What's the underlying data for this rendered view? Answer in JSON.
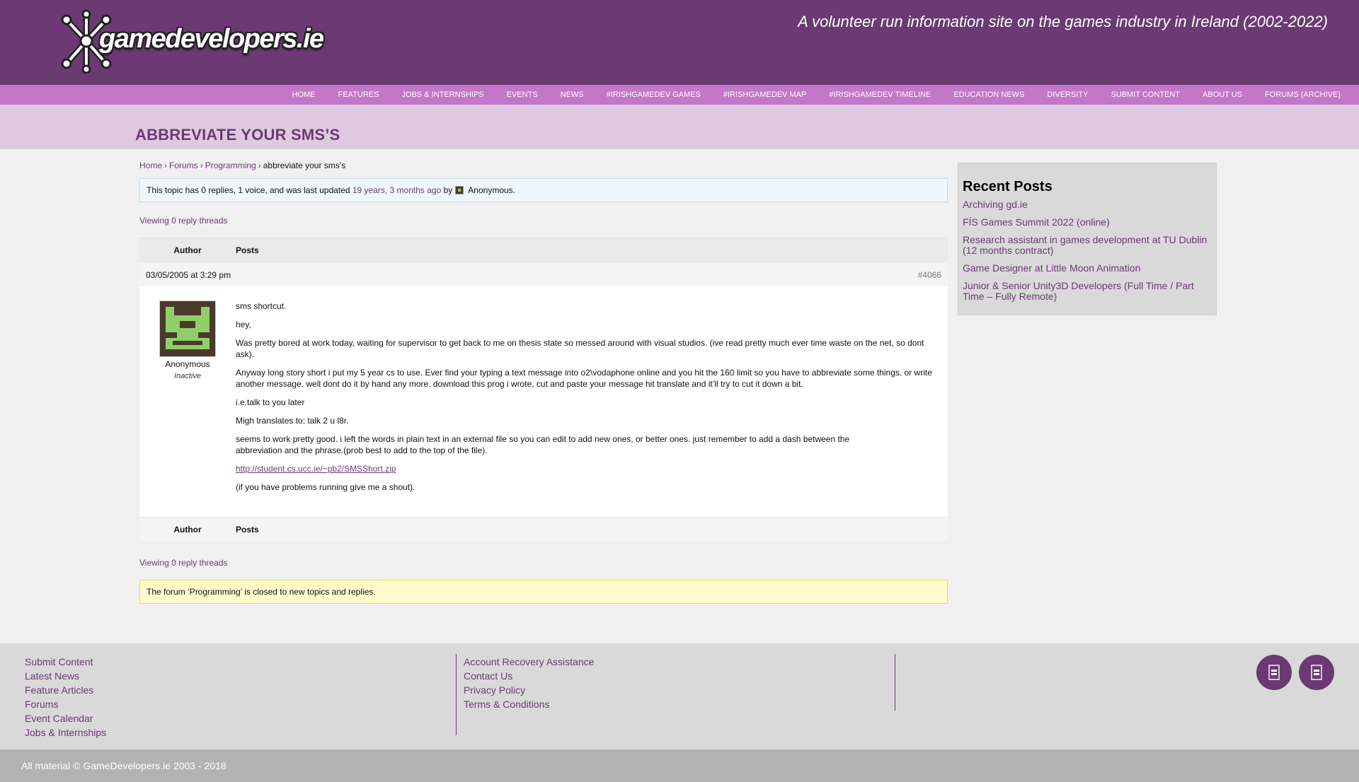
{
  "header": {
    "logo_text": "gamedevelopers.ie",
    "tagline": "A volunteer run information site on the games industry in Ireland (2002-2022)"
  },
  "nav": {
    "items": [
      {
        "label": "HOME"
      },
      {
        "label": "FEATURES"
      },
      {
        "label": "JOBS & INTERNSHIPS"
      },
      {
        "label": "EVENTS"
      },
      {
        "label": "NEWS"
      },
      {
        "label": "#IRISHGAMEDEV GAMES"
      },
      {
        "label": "#IRISHGAMEDEV MAP"
      },
      {
        "label": "#IRISHGAMEDEV TIMELINE"
      },
      {
        "label": "EDUCATION NEWS"
      },
      {
        "label": "DIVERSITY"
      },
      {
        "label": "SUBMIT CONTENT"
      },
      {
        "label": "ABOUT US"
      },
      {
        "label": "FORUMS (ARCHIVE)"
      }
    ]
  },
  "page": {
    "title": "ABBREVIATE YOUR SMS’S"
  },
  "breadcrumb": {
    "home": "Home",
    "forums": "Forums",
    "programming": "Programming",
    "current": "abbreviate your sms’s",
    "sep": "›"
  },
  "topic_info": {
    "prefix": "This topic has 0 replies, 1 voice, and was last updated",
    "freshness": "19 years, 3 months ago",
    "by": "by",
    "author": "Anonymous",
    "suffix": "."
  },
  "viewing_text": "Viewing 0 reply threads",
  "thread": {
    "col_author": "Author",
    "col_posts": "Posts",
    "post": {
      "date": "03/05/2005 at 3:29 pm",
      "id": "#4066",
      "author_name": "Anonymous",
      "author_role": "Inactive",
      "paragraphs": [
        "sms shortcut.",
        "hey,",
        "Was pretty bored at work today, waiting for supervisor to get back to me on thesis state so messed around with visual studios. (ive read pretty much ever time waste on the net, so dont ask).",
        "Anyway long story short i put my 5 year cs to use. Ever find your typing a text message into o2\\vodaphone online and you hit the 160 limit so you have to abbreviate some things. or write another message. well dont do it by hand any more. download this prog i wrote, cut and paste your message hit translate and it’ll try to cut it down a bit.",
        "i.e.talk to you later",
        "Migh translates to: talk 2 u l8r.",
        "seems to work pretty good. i left the words in plain text in an external file so you can edit to add new ones, or better ones. just remember to add a dash between the abbreviation and the phrase.(prob best to add to the top of the file)."
      ],
      "link": "http://student.cs.ucc.ie/~pb2/SMSShort.zip",
      "closing": "(if you have problems running give me a shout)."
    }
  },
  "closed_notice": "The forum ‘Programming’ is closed to new topics and replies.",
  "sidebar": {
    "heading": "Recent Posts",
    "posts": [
      "Archiving gd.ie",
      "FÍS Games Summit 2022 (online)",
      "Research assistant in games development at TU Dublin (12 months contract)",
      "Game Designer at Little Moon Animation",
      "Junior & Senior Unity3D Developers (Full Time / Part Time – Fully Remote)"
    ]
  },
  "footer": {
    "col1": [
      "Submit Content",
      "Latest News",
      "Feature Articles",
      "Forums",
      "Event Calendar",
      "Jobs & Internships"
    ],
    "col2": [
      "Account Recovery Assistance",
      "Contact Us",
      "Privacy Policy",
      "Terms & Conditions"
    ],
    "copyright": "All material © GameDevelopers.ie 2003 - 2018"
  },
  "icons": {
    "social1": "twitter-icon",
    "social2": "facebook-icon",
    "accent_color": "#6b3a73",
    "nav_color": "#c476c8"
  }
}
